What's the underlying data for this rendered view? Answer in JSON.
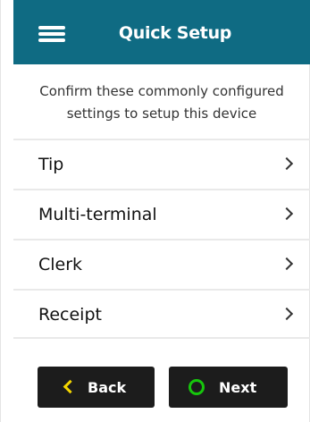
{
  "header": {
    "title": "Quick Setup",
    "menu_icon": "hamburger-menu-icon",
    "background_color": "#0f6b83"
  },
  "intro": {
    "line1": "Confirm these commonly configured",
    "line2": "settings to setup this device"
  },
  "list": {
    "items": [
      {
        "label": "Tip",
        "icon": "chevron-right-icon"
      },
      {
        "label": "Multi-terminal",
        "icon": "chevron-right-icon"
      },
      {
        "label": "Clerk",
        "icon": "chevron-right-icon"
      },
      {
        "label": "Receipt",
        "icon": "chevron-right-icon"
      }
    ]
  },
  "footer": {
    "back_label": "Back",
    "back_icon": "chevron-left-icon",
    "back_icon_color": "#f4d600",
    "next_label": "Next",
    "next_icon": "circle-icon",
    "next_icon_color": "#16c60c",
    "button_color": "#1c1c1c"
  }
}
